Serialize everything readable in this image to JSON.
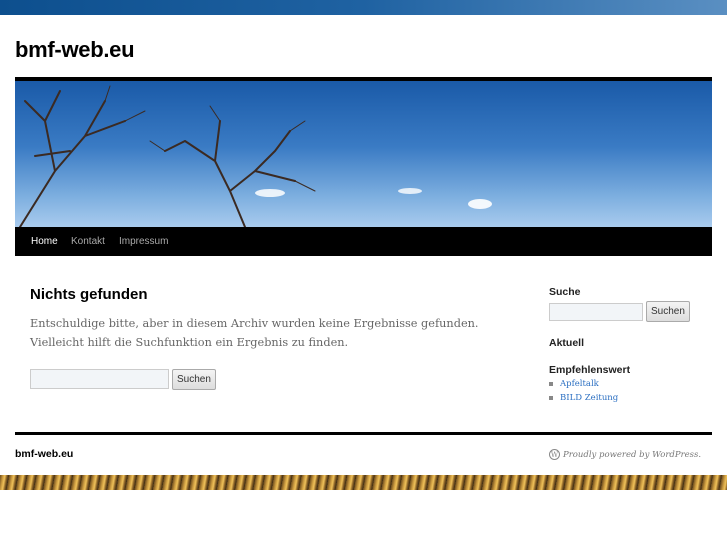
{
  "site": {
    "title": "bmf-web.eu"
  },
  "nav": {
    "items": [
      {
        "label": "Home",
        "current": true
      },
      {
        "label": "Kontakt"
      },
      {
        "label": "Impressum"
      }
    ]
  },
  "main": {
    "title": "Nichts gefunden",
    "text": "Entschuldige bitte, aber in diesem Archiv wurden keine Ergebnisse gefunden. Vielleicht hilft die Suchfunktion ein Ergebnis zu finden.",
    "search_value": "",
    "search_button": "Suchen"
  },
  "sidebar": {
    "search_title": "Suche",
    "search_value": "",
    "search_button": "Suchen",
    "aktuell_title": "Aktuell",
    "links_title": "Empfehlenswert",
    "links": [
      {
        "label": "Apfeltalk"
      },
      {
        "label": "BILD Zeitung"
      }
    ]
  },
  "footer": {
    "title": "bmf-web.eu",
    "powered": "Proudly powered by WordPress.",
    "wp_icon_glyph": "W"
  }
}
